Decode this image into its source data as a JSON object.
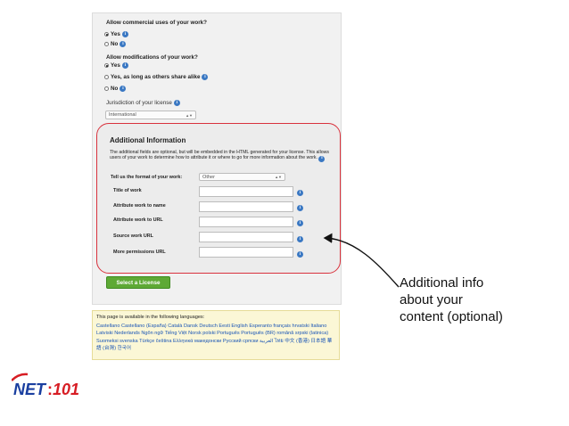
{
  "form": {
    "q_commercial": "Allow commercial uses of your work?",
    "commercial_options": [
      {
        "label": "Yes",
        "checked": true
      },
      {
        "label": "No",
        "checked": false
      }
    ],
    "q_modifications": "Allow modifications of your work?",
    "modification_options": [
      {
        "label": "Yes",
        "checked": true
      },
      {
        "label": "Yes, as long as others share alike",
        "checked": false
      },
      {
        "label": "No",
        "checked": false
      }
    ],
    "jurisdiction_label": "Jurisdiction of your license",
    "jurisdiction_value": "International"
  },
  "additional_info": {
    "title": "Additional Information",
    "description": "The additional fields are optional, but will be embedded in the HTML generated for your license. This allows users of your work to determine how to attribute it or where to go for more information about the work.",
    "format_label": "Tell us the format of your work:",
    "format_value": "Other",
    "fields": [
      {
        "label": "Title of work",
        "value": ""
      },
      {
        "label": "Attribute work to name",
        "value": ""
      },
      {
        "label": "Attribute work to URL",
        "value": ""
      },
      {
        "label": "Source work URL",
        "value": ""
      },
      {
        "label": "More permissions URL",
        "value": ""
      }
    ]
  },
  "select_button": "Select a License",
  "languages": {
    "title": "This page is available in the following languages:",
    "list": "Castellano Castellano (España) Català Dansk Deutsch Eesti English Esperanto français hrvatski Italiano Latviski Nederlands Ngôn ngữ Tiếng Việt Norsk polski Português Português (BR) română srpski (latinica) Suomeksi svenska Türkçe čeština Ελληνικά македонски Русский српски العربية ไทย 中文 (香港) 日本語 華語 (台灣) 한국어"
  },
  "annotation": {
    "line1": "Additional info",
    "line2": "about your",
    "line3": "content (optional)"
  },
  "logo": {
    "text": "NET:101",
    "colors": {
      "net": "#1a3fa0",
      "num": "#d71d24"
    }
  },
  "colors": {
    "highlight_border": "#d9323d",
    "button_green": "#5ea935",
    "info_blue": "#3a78c3",
    "lang_bg": "#fbf7d6"
  }
}
